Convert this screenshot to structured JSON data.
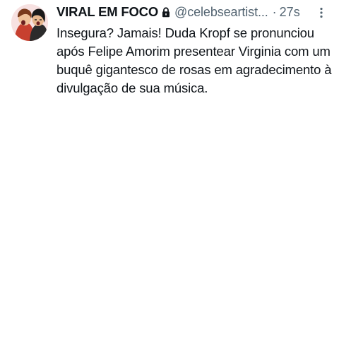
{
  "tweet": {
    "display_name": "VIRAL EM FOCO",
    "protected_icon": "lock-icon",
    "handle": "@celebseartist...",
    "separator": "·",
    "time": "27s",
    "more_icon": "more-vertical-icon",
    "text": "Insegura? Jamais! Duda Kropf se pronunciou após Felipe Amorim presentear Virginia com um buquê gigantesco de rosas em agradecimento à divulgação de sua música."
  },
  "colors": {
    "primary_text": "#0f1419",
    "secondary_text": "#536471",
    "background": "#ffffff"
  }
}
